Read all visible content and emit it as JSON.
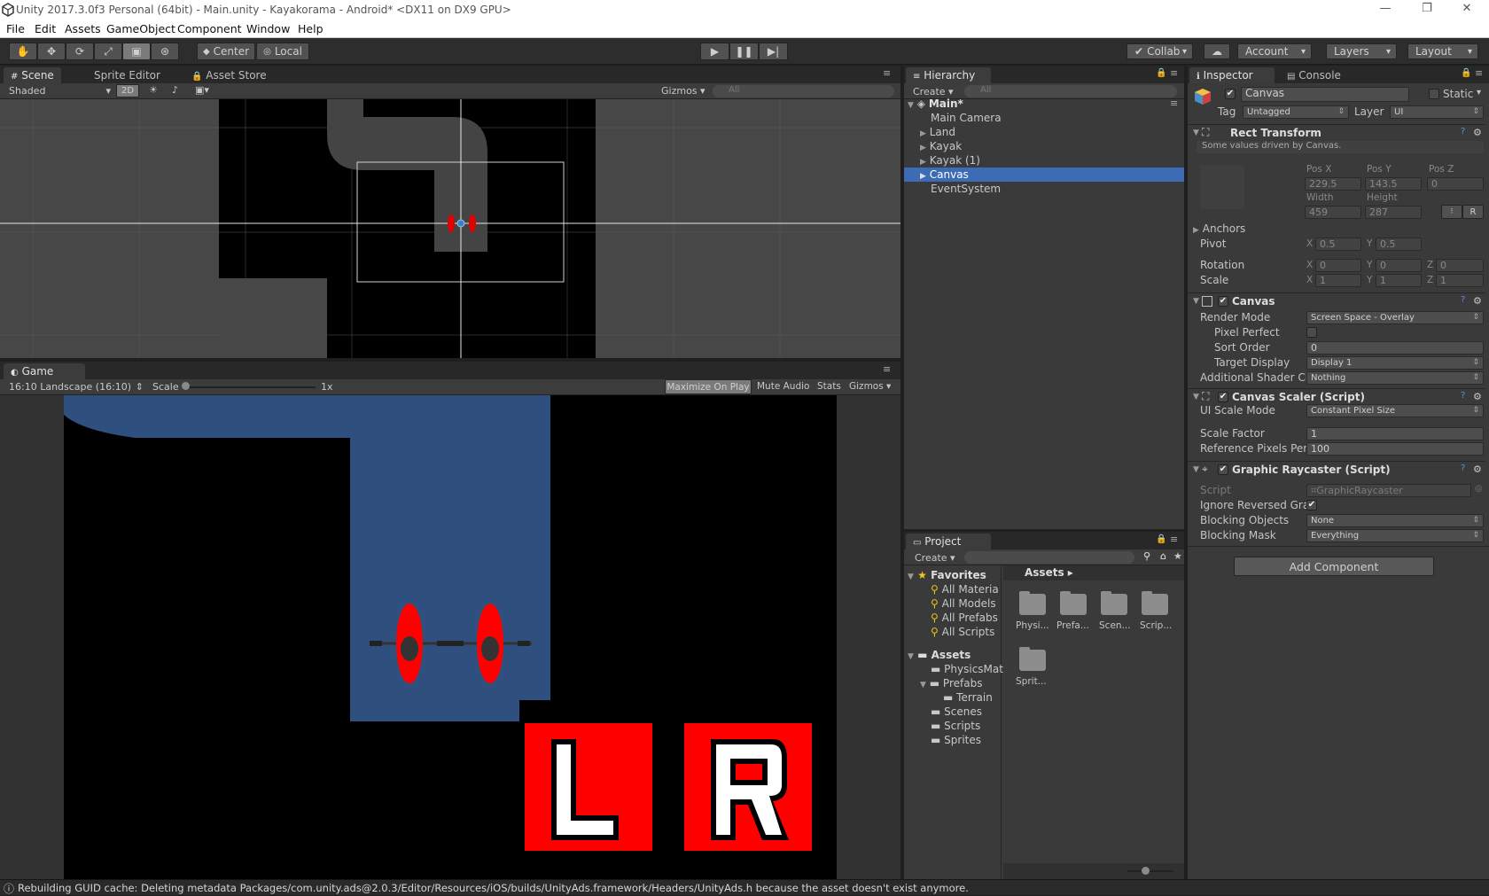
{
  "window": {
    "title": "Unity 2017.3.0f3 Personal (64bit) - Main.unity - Kayakorama - Android* <DX11 on DX9 GPU>"
  },
  "menu": [
    "File",
    "Edit",
    "Assets",
    "GameObject",
    "Component",
    "Window",
    "Help"
  ],
  "toolbar": {
    "pivot": "Center",
    "space": "Local",
    "collab": "Collab",
    "account": "Account",
    "layers": "Layers",
    "layout": "Layout"
  },
  "scene": {
    "tabs": [
      "Scene",
      "Sprite Editor",
      "Asset Store"
    ],
    "shading": "Shaded",
    "mode2d": "2D",
    "gizmos": "Gizmos",
    "search_placeholder": "All"
  },
  "game": {
    "tab": "Game",
    "aspect": "16:10 Landscape (16:10)",
    "scale_label": "Scale",
    "scale_value": "1x",
    "buttons": [
      "Maximize On Play",
      "Mute Audio",
      "Stats",
      "Gizmos"
    ],
    "left_button": "L",
    "right_button": "R"
  },
  "hierarchy": {
    "tab": "Hierarchy",
    "create": "Create",
    "search_placeholder": "All",
    "scene": "Main*",
    "items": [
      "Main Camera",
      "Land",
      "Kayak",
      "Kayak (1)",
      "Canvas",
      "EventSystem"
    ],
    "selected": "Canvas"
  },
  "project": {
    "tab": "Project",
    "create": "Create",
    "favorites_label": "Favorites",
    "favorites": [
      "All Materia",
      "All Models",
      "All Prefabs",
      "All Scripts"
    ],
    "assets_label": "Assets",
    "assets_tree": [
      "PhysicsMat",
      "Prefabs",
      "Terrain",
      "Scenes",
      "Scripts",
      "Sprites"
    ],
    "breadcrumb": "Assets",
    "grid": [
      "Physi...",
      "Prefa...",
      "Scen...",
      "Scrip...",
      "Sprit..."
    ]
  },
  "inspector": {
    "tabs": [
      "Inspector",
      "Console"
    ],
    "object_name": "Canvas",
    "static": "Static",
    "tag_label": "Tag",
    "tag_value": "Untagged",
    "layer_label": "Layer",
    "layer_value": "UI",
    "rect": {
      "title": "Rect Transform",
      "note": "Some values driven by Canvas.",
      "posx_label": "Pos X",
      "posy_label": "Pos Y",
      "posz_label": "Pos Z",
      "posx": "229.5",
      "posy": "143.5",
      "posz": "0",
      "width_label": "Width",
      "height_label": "Height",
      "width": "459",
      "height": "287",
      "anchors": "Anchors",
      "pivot": "Pivot",
      "pivot_x": "0.5",
      "pivot_y": "0.5",
      "rotation": "Rotation",
      "rot_x": "0",
      "rot_y": "0",
      "rot_z": "0",
      "scale": "Scale",
      "scale_x": "1",
      "scale_y": "1",
      "scale_z": "1",
      "r_button": "R"
    },
    "canvas": {
      "title": "Canvas",
      "render_mode_label": "Render Mode",
      "render_mode": "Screen Space - Overlay",
      "pixel_perfect": "Pixel Perfect",
      "sort_order_label": "Sort Order",
      "sort_order": "0",
      "target_display_label": "Target Display",
      "target_display": "Display 1",
      "shader_label": "Additional Shader Cl",
      "shader_value": "Nothing"
    },
    "scaler": {
      "title": "Canvas Scaler (Script)",
      "mode_label": "UI Scale Mode",
      "mode": "Constant Pixel Size",
      "factor_label": "Scale Factor",
      "factor": "1",
      "ref_label": "Reference Pixels Per",
      "ref": "100"
    },
    "raycaster": {
      "title": "Graphic Raycaster (Script)",
      "script_label": "Script",
      "script": "GraphicRaycaster",
      "ignore_label": "Ignore Reversed Gra",
      "blocking_label": "Blocking Objects",
      "blocking": "None",
      "mask_label": "Blocking Mask",
      "mask": "Everything"
    },
    "add_component": "Add Component"
  },
  "status": {
    "text": "Rebuilding GUID cache: Deleting metadata Packages/com.unity.ads@2.0.3/Editor/Resources/iOS/builds/UnityAds.framework/Headers/UnityAds.h because the asset doesn't exist anymore."
  },
  "colors": {
    "selection": "#3d6cb6",
    "water": "#2f4f7f",
    "kayak": "#e00000",
    "button_red": "#ff0000"
  }
}
